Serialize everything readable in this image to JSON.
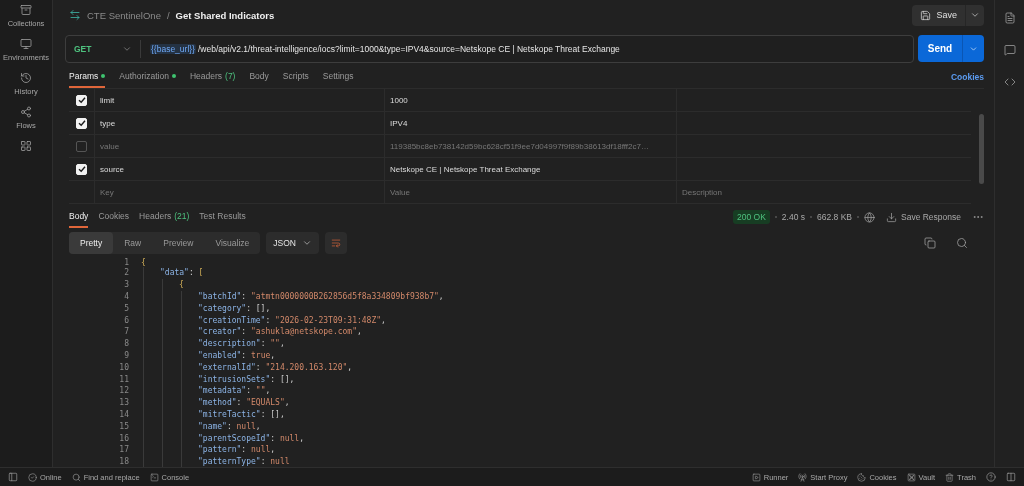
{
  "sidebar": {
    "items": [
      {
        "label": "Collections",
        "kind": "collections"
      },
      {
        "label": "Environments",
        "kind": "environments"
      },
      {
        "label": "History",
        "kind": "history"
      },
      {
        "label": "Flows",
        "kind": "flows"
      },
      {
        "kind": "add"
      }
    ]
  },
  "breadcrumb": {
    "collection": "CTE SentinelOne",
    "separator": "/",
    "request": "Get Shared Indicators"
  },
  "save_button": {
    "label": "Save"
  },
  "request": {
    "method": "GET",
    "variable": "{{base_url}}",
    "path": "/web/api/v2.1/threat-intelligence/iocs?limit=1000&type=IPV4&source=Netskope CE | Netskope Threat Exchange",
    "send_label": "Send"
  },
  "request_tabs": [
    {
      "label": "Params",
      "dot": true,
      "selected": true
    },
    {
      "label": "Authorization",
      "dot": true,
      "selected": false
    },
    {
      "label": "Headers",
      "count": "(7)",
      "dot": false,
      "selected": false
    },
    {
      "label": "Body",
      "dot": false,
      "selected": false
    },
    {
      "label": "Scripts",
      "dot": false,
      "selected": false
    },
    {
      "label": "Settings",
      "dot": false,
      "selected": false
    }
  ],
  "cookies_link": "Cookies",
  "params": {
    "rows": [
      {
        "key": "limit",
        "value": "1000",
        "checked": true
      },
      {
        "key": "type",
        "value": "IPV4",
        "checked": true
      },
      {
        "key": "value",
        "value": "119385bc8eb738142d59bc628cf51f9ee7d04997f9f89b38613df18fff2c7…",
        "checked": false
      },
      {
        "key": "source",
        "value": "Netskope CE | Netskope Threat Exchange",
        "checked": true
      }
    ],
    "new_row": {
      "key": {
        "placeholder": "Key"
      },
      "value": {
        "placeholder": "Value"
      },
      "description": {
        "placeholder": "Description"
      }
    }
  },
  "response_tabs": [
    {
      "label": "Body",
      "selected": true
    },
    {
      "label": "Cookies",
      "selected": false
    },
    {
      "label": "Headers",
      "count": "(21)",
      "selected": false
    },
    {
      "label": "Test Results",
      "selected": false
    }
  ],
  "response_meta": {
    "status": "200 OK",
    "time": "2.40 s",
    "size": "662.8 KB",
    "save_label": "Save Response"
  },
  "view_tabs": [
    {
      "label": "Pretty",
      "selected": true
    },
    {
      "label": "Raw",
      "selected": false
    },
    {
      "label": "Preview",
      "selected": false
    },
    {
      "label": "Visualize",
      "selected": false
    }
  ],
  "format": "JSON",
  "code": [
    {
      "number": "1",
      "tokens": [
        {
          "kind": "bracket",
          "text": "{"
        }
      ],
      "children": [
        {
          "number": "2",
          "tokens": [
            {
              "kind": "key",
              "text": "\"data\""
            },
            {
              "kind": "punct",
              "text": ": "
            },
            {
              "kind": "bracket",
              "text": "["
            }
          ],
          "children": [
            {
              "number": "3",
              "tokens": [
                {
                  "kind": "bracket",
                  "text": "{"
                }
              ],
              "children": [
                {
                  "number": "4",
                  "tokens": [
                    {
                      "kind": "key",
                      "text": "\"batchId\""
                    },
                    {
                      "kind": "punct",
                      "text": ": "
                    },
                    {
                      "kind": "string",
                      "text": "\"atmtn0000000B262856d5f8a334809bf938b7\""
                    },
                    {
                      "kind": "punct",
                      "text": ","
                    }
                  ]
                },
                {
                  "number": "5",
                  "tokens": [
                    {
                      "kind": "key",
                      "text": "\"category\""
                    },
                    {
                      "kind": "punct",
                      "text": ": [],"
                    }
                  ]
                },
                {
                  "number": "6",
                  "tokens": [
                    {
                      "kind": "key",
                      "text": "\"creationTime\""
                    },
                    {
                      "kind": "punct",
                      "text": ": "
                    },
                    {
                      "kind": "string",
                      "text": "\"2026-02-23T09:31:48Z\""
                    },
                    {
                      "kind": "punct",
                      "text": ","
                    }
                  ]
                },
                {
                  "number": "7",
                  "tokens": [
                    {
                      "kind": "key",
                      "text": "\"creator\""
                    },
                    {
                      "kind": "punct",
                      "text": ": "
                    },
                    {
                      "kind": "string",
                      "text": "\"ashukla@netskope.com\""
                    },
                    {
                      "kind": "punct",
                      "text": ","
                    }
                  ]
                },
                {
                  "number": "8",
                  "tokens": [
                    {
                      "kind": "key",
                      "text": "\"description\""
                    },
                    {
                      "kind": "punct",
                      "text": ": "
                    },
                    {
                      "kind": "string",
                      "text": "\"\""
                    },
                    {
                      "kind": "punct",
                      "text": ","
                    }
                  ]
                },
                {
                  "number": "9",
                  "tokens": [
                    {
                      "kind": "key",
                      "text": "\"enabled\""
                    },
                    {
                      "kind": "punct",
                      "text": ": "
                    },
                    {
                      "kind": "literal",
                      "text": "true"
                    },
                    {
                      "kind": "punct",
                      "text": ","
                    }
                  ]
                },
                {
                  "number": "10",
                  "tokens": [
                    {
                      "kind": "key",
                      "text": "\"externalId\""
                    },
                    {
                      "kind": "punct",
                      "text": ": "
                    },
                    {
                      "kind": "string",
                      "text": "\"214.200.163.120\""
                    },
                    {
                      "kind": "punct",
                      "text": ","
                    }
                  ]
                },
                {
                  "number": "11",
                  "tokens": [
                    {
                      "kind": "key",
                      "text": "\"intrusionSets\""
                    },
                    {
                      "kind": "punct",
                      "text": ": [],"
                    }
                  ]
                },
                {
                  "number": "12",
                  "tokens": [
                    {
                      "kind": "key",
                      "text": "\"metadata\""
                    },
                    {
                      "kind": "punct",
                      "text": ": "
                    },
                    {
                      "kind": "string",
                      "text": "\"\""
                    },
                    {
                      "kind": "punct",
                      "text": ","
                    }
                  ]
                },
                {
                  "number": "13",
                  "tokens": [
                    {
                      "kind": "key",
                      "text": "\"method\""
                    },
                    {
                      "kind": "punct",
                      "text": ": "
                    },
                    {
                      "kind": "string",
                      "text": "\"EQUALS\""
                    },
                    {
                      "kind": "punct",
                      "text": ","
                    }
                  ]
                },
                {
                  "number": "14",
                  "tokens": [
                    {
                      "kind": "key",
                      "text": "\"mitreTactic\""
                    },
                    {
                      "kind": "punct",
                      "text": ": [],"
                    }
                  ]
                },
                {
                  "number": "15",
                  "tokens": [
                    {
                      "kind": "key",
                      "text": "\"name\""
                    },
                    {
                      "kind": "punct",
                      "text": ": "
                    },
                    {
                      "kind": "literal",
                      "text": "null"
                    },
                    {
                      "kind": "punct",
                      "text": ","
                    }
                  ]
                },
                {
                  "number": "16",
                  "tokens": [
                    {
                      "kind": "key",
                      "text": "\"parentScopeId\""
                    },
                    {
                      "kind": "punct",
                      "text": ": "
                    },
                    {
                      "kind": "literal",
                      "text": "null"
                    },
                    {
                      "kind": "punct",
                      "text": ","
                    }
                  ]
                },
                {
                  "number": "17",
                  "tokens": [
                    {
                      "kind": "key",
                      "text": "\"pattern\""
                    },
                    {
                      "kind": "punct",
                      "text": ": "
                    },
                    {
                      "kind": "literal",
                      "text": "null"
                    },
                    {
                      "kind": "punct",
                      "text": ","
                    }
                  ]
                },
                {
                  "number": "18",
                  "tokens": [
                    {
                      "kind": "key",
                      "text": "\"patternType\""
                    },
                    {
                      "kind": "punct",
                      "text": ": "
                    },
                    {
                      "kind": "literal",
                      "text": "null"
                    }
                  ]
                }
              ]
            }
          ]
        }
      ]
    }
  ],
  "status_bar": {
    "left": [
      {
        "label": "Online",
        "kind": "online"
      },
      {
        "label": "Find and replace",
        "kind": "find"
      },
      {
        "label": "Console",
        "kind": "console"
      }
    ],
    "right": [
      {
        "label": "Runner",
        "kind": "runner"
      },
      {
        "label": "Start Proxy",
        "kind": "proxy"
      },
      {
        "label": "Cookies",
        "kind": "cookies"
      },
      {
        "label": "Vault",
        "kind": "vault"
      },
      {
        "label": "Trash",
        "kind": "trash"
      }
    ]
  }
}
